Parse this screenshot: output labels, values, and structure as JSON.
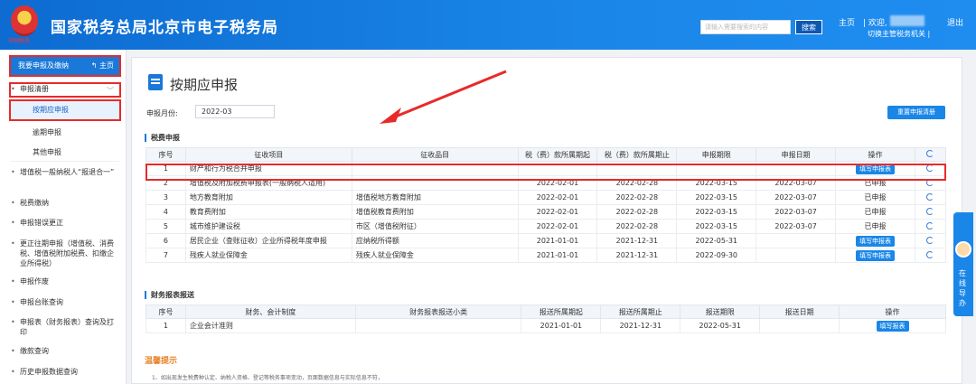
{
  "header": {
    "title": "国家税务总局北京市电子税务局",
    "emblem_text": "中国税务",
    "search_placeholder": "请输入需要搜索的内容",
    "search_button": "搜索",
    "home": "主页",
    "welcome": "| 欢迎,",
    "logout": "退出",
    "switch_role": "切换主管税务机关   |"
  },
  "sidebar": {
    "head_label": "我要申报及缴纳",
    "head_home": "主页",
    "items": [
      {
        "label": "申报清册"
      },
      {
        "label": "按期应申报"
      },
      {
        "label": "逾期申报"
      },
      {
        "label": "其他申报"
      },
      {
        "label": "增值税一般纳税人“报退合一”"
      },
      {
        "label": "税费缴纳"
      },
      {
        "label": "申报错误更正"
      },
      {
        "label": "更正往期申报（增值税、消费税、增值税附加税费、扣缴企业所得税）"
      },
      {
        "label": "申报作废"
      },
      {
        "label": "申报台账查询"
      },
      {
        "label": "申报表（财务报表）查询及打印"
      },
      {
        "label": "缴款查询"
      },
      {
        "label": "历史申报数据查询"
      }
    ]
  },
  "main": {
    "title": "按期应申报",
    "period_label": "申报月份:",
    "period_value": "2022-03",
    "reset_button": "重置申报清册",
    "tax_section": "税费申报",
    "tax_headers": [
      "序号",
      "征收项目",
      "征收品目",
      "税（费）款所属期起",
      "税（费）款所属期止",
      "申报期限",
      "申报日期",
      "操作"
    ],
    "tax_rows": [
      {
        "no": "1",
        "item": "财产和行为税合并申报",
        "sub": "",
        "start": "",
        "end": "",
        "deadline": "",
        "date": "",
        "op": "填写申报表",
        "op_is_button": true
      },
      {
        "no": "2",
        "item": "增值税及附加税费申报表(一般纳税人适用)",
        "sub": "",
        "start": "2022-02-01",
        "end": "2022-02-28",
        "deadline": "2022-03-15",
        "date": "2022-03-07",
        "op": "已申报",
        "op_is_button": false
      },
      {
        "no": "3",
        "item": "地方教育附加",
        "sub": "增值税地方教育附加",
        "start": "2022-02-01",
        "end": "2022-02-28",
        "deadline": "2022-03-15",
        "date": "2022-03-07",
        "op": "已申报",
        "op_is_button": false
      },
      {
        "no": "4",
        "item": "教育费附加",
        "sub": "增值税教育费附加",
        "start": "2022-02-01",
        "end": "2022-02-28",
        "deadline": "2022-03-15",
        "date": "2022-03-07",
        "op": "已申报",
        "op_is_button": false
      },
      {
        "no": "5",
        "item": "城市维护建设税",
        "sub": "市区（增值税附征）",
        "start": "2022-02-01",
        "end": "2022-02-28",
        "deadline": "2022-03-15",
        "date": "2022-03-07",
        "op": "已申报",
        "op_is_button": false
      },
      {
        "no": "6",
        "item": "居民企业（查账征收）企业所得税年度申报",
        "sub": "应纳税所得额",
        "start": "2021-01-01",
        "end": "2021-12-31",
        "deadline": "2022-05-31",
        "date": "",
        "op": "填写申报表",
        "op_is_button": true
      },
      {
        "no": "7",
        "item": "残疾人就业保障金",
        "sub": "残疾人就业保障金",
        "start": "2021-01-01",
        "end": "2021-12-31",
        "deadline": "2022-09-30",
        "date": "",
        "op": "填写申报表",
        "op_is_button": true
      }
    ],
    "fin_section": "财务报表报送",
    "fin_headers": [
      "序号",
      "财务、会计制度",
      "财务报表报送小类",
      "报送所属期起",
      "报送所属期止",
      "报送期限",
      "报送日期",
      "操作"
    ],
    "fin_rows": [
      {
        "no": "1",
        "system": "企业会计准则",
        "sub": "",
        "start": "2021-01-01",
        "end": "2021-12-31",
        "deadline": "2022-05-31",
        "date": "",
        "op": "填写报表"
      }
    ],
    "tips_title": "温馨提示",
    "tips_text": "1、如出现发生税费种认定、纳税人资格、登记等税务事项变动，页面数据信息与实际信息不符，"
  },
  "float": {
    "text": "在线导办"
  }
}
